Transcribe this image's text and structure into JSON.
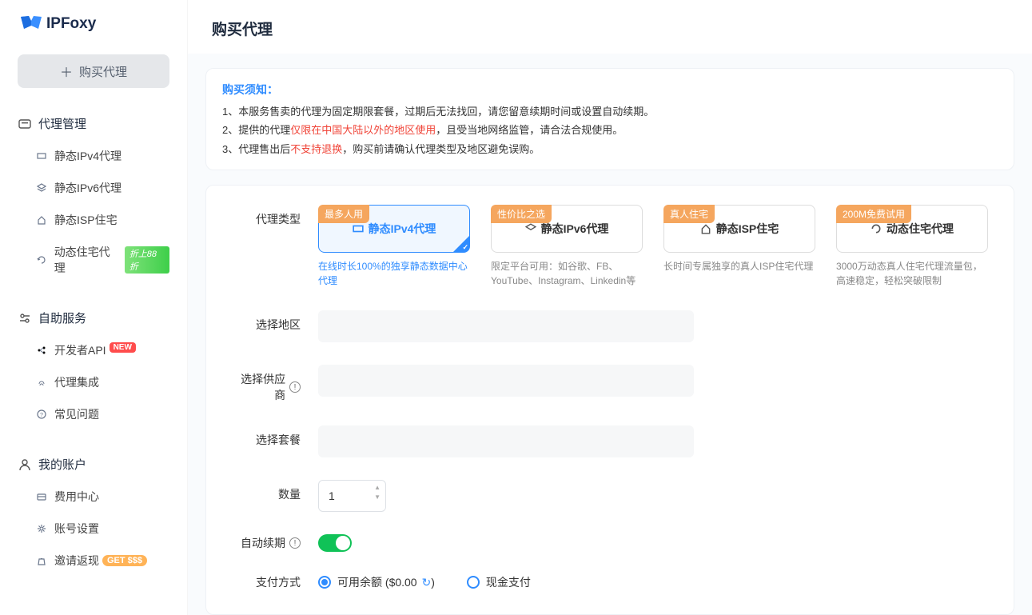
{
  "brand": {
    "name": "IPFoxy"
  },
  "sidebar": {
    "buy_button": "购买代理",
    "sections": [
      {
        "title": "代理管理",
        "items": [
          {
            "label": "静态IPv4代理"
          },
          {
            "label": "静态IPv6代理"
          },
          {
            "label": "静态ISP住宅"
          },
          {
            "label": "动态住宅代理",
            "badge": "折上88折"
          }
        ]
      },
      {
        "title": "自助服务",
        "items": [
          {
            "label": "开发者API",
            "new_badge": "NEW"
          },
          {
            "label": "代理集成"
          },
          {
            "label": "常见问题"
          }
        ]
      },
      {
        "title": "我的账户",
        "items": [
          {
            "label": "费用中心"
          },
          {
            "label": "账号设置"
          },
          {
            "label": "邀请返现",
            "get_badge": "GET $$$"
          }
        ]
      }
    ]
  },
  "page": {
    "title": "购买代理"
  },
  "notice": {
    "title": "购买须知：",
    "line1_prefix": "1、本服务售卖的代理为固定期限套餐，过期后无法找回，请您留意续期时间或设置自动续期。",
    "line2_prefix": "2、提供的代理",
    "line2_red": "仅限在中国大陆以外的地区使用",
    "line2_suffix": "，且受当地网络监管，请合法合规使用。",
    "line3_prefix": "3、代理售出后",
    "line3_red": "不支持退换",
    "line3_suffix": "，购买前请确认代理类型及地区避免误购。"
  },
  "form": {
    "labels": {
      "type": "代理类型",
      "region": "选择地区",
      "provider": "选择供应商",
      "package": "选择套餐",
      "quantity": "数量",
      "auto_renew": "自动续期",
      "pay_method": "支付方式"
    },
    "types": [
      {
        "tag": "最多人用",
        "title": "静态IPv4代理",
        "desc": "在线时长100%的独享静态数据中心代理",
        "active": true
      },
      {
        "tag": "性价比之选",
        "title": "静态IPv6代理",
        "desc": "限定平台可用：如谷歌、FB、YouTube、Instagram、Linkedin等"
      },
      {
        "tag": "真人住宅",
        "title": "静态ISP住宅",
        "desc": "长时间专属独享的真人ISP住宅代理"
      },
      {
        "tag": "200M免费试用",
        "title": "动态住宅代理",
        "desc": "3000万动态真人住宅代理流量包，高速稳定，轻松突破限制"
      }
    ],
    "quantity": "1",
    "auto_renew": true,
    "balance_label_prefix": "可用余额 (",
    "balance_amount": "$0.00",
    "balance_label_suffix": ")",
    "cash_label": "现金支付"
  }
}
